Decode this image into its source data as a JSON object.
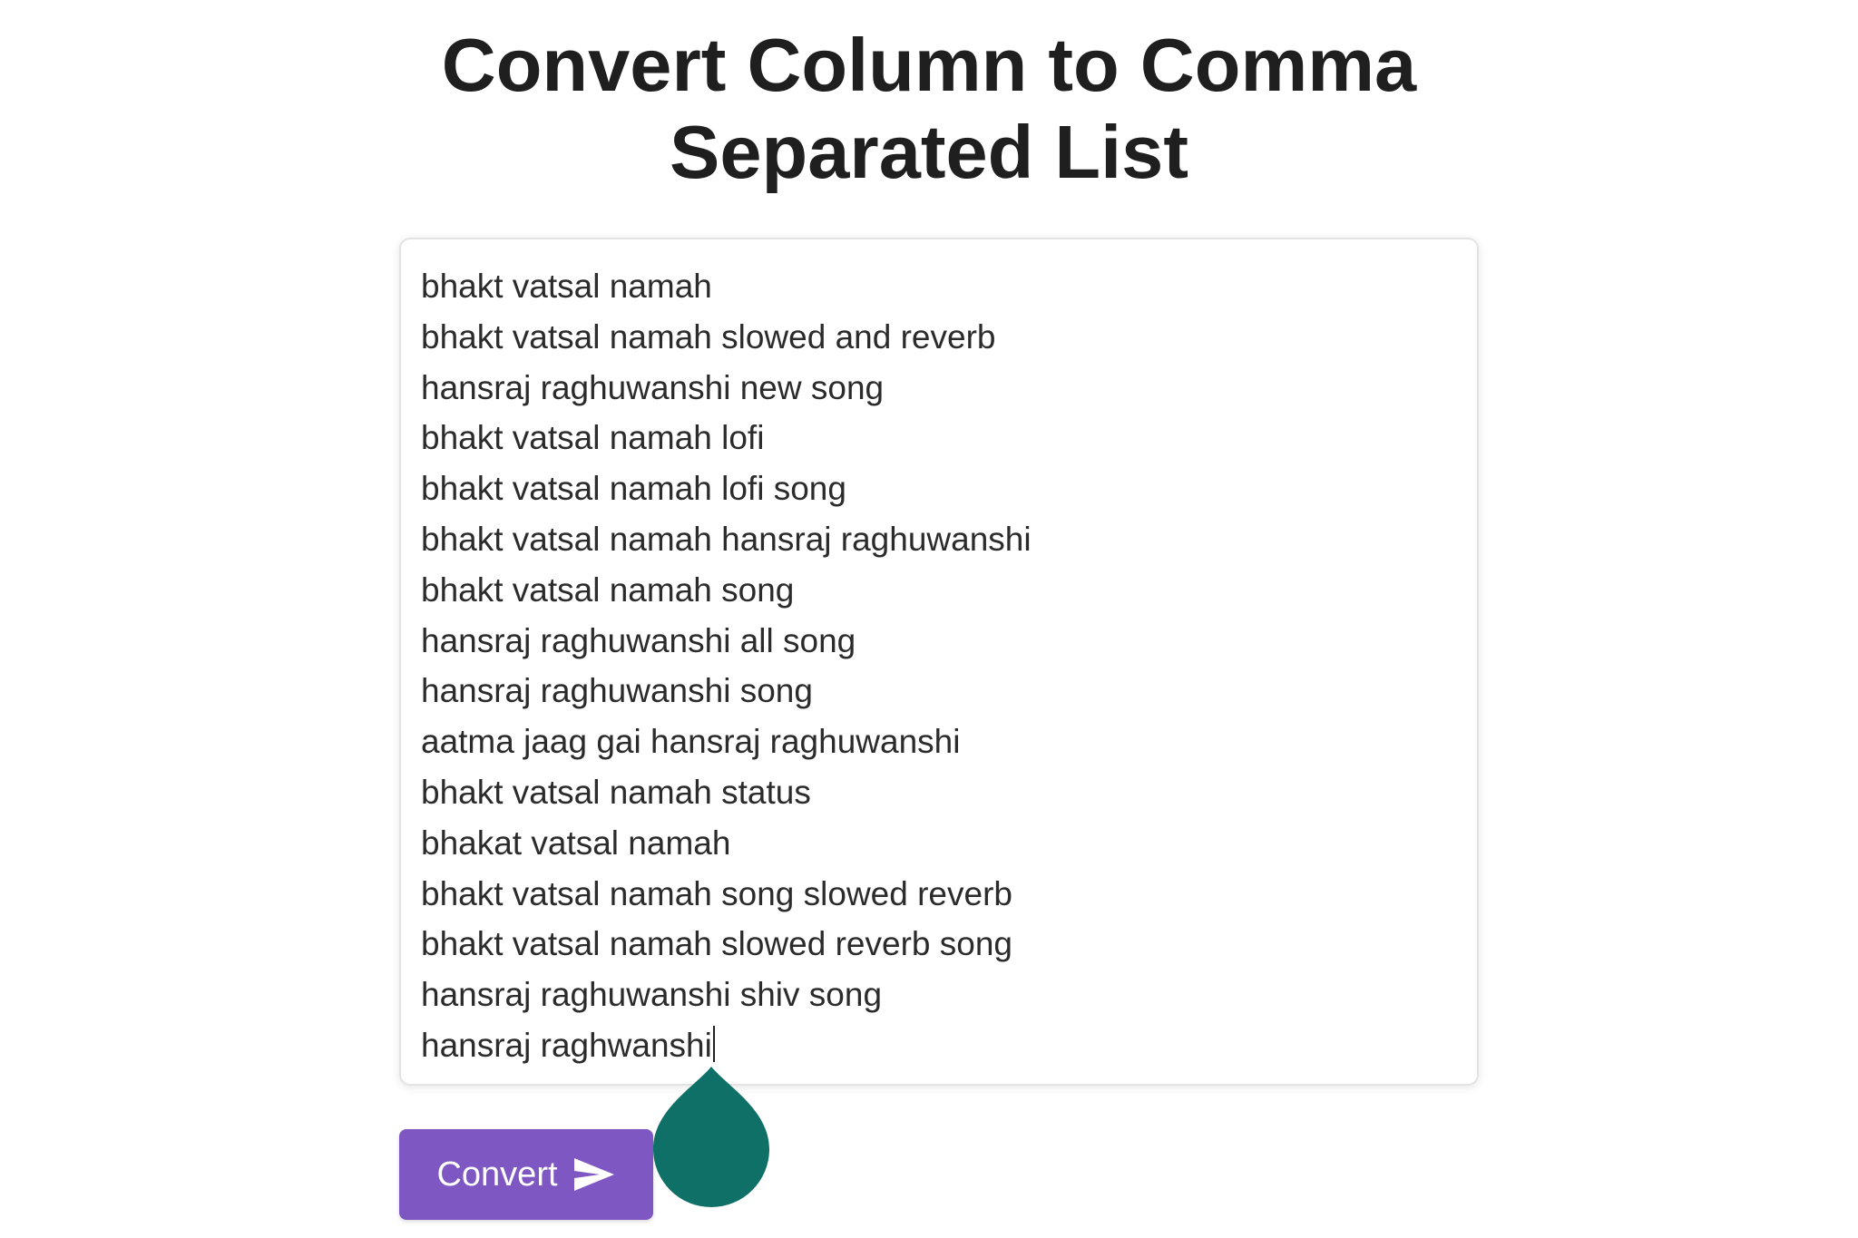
{
  "page": {
    "title_line1": "Convert Column to Comma",
    "title_line2": "Separated List"
  },
  "input": {
    "lines": [
      "bhakt vatsal namah",
      "bhakt vatsal namah slowed and reverb",
      "hansraj raghuwanshi new song",
      "bhakt vatsal namah lofi",
      "bhakt vatsal namah lofi song",
      "bhakt vatsal namah hansraj raghuwanshi",
      "bhakt vatsal namah song",
      "hansraj raghuwanshi all song",
      "hansraj raghuwanshi song",
      "aatma jaag gai hansraj raghuwanshi",
      "bhakt vatsal namah status",
      "bhakat vatsal namah",
      "bhakt vatsal namah song slowed reverb",
      "bhakt vatsal namah slowed reverb song",
      "hansraj raghuwanshi shiv song",
      "hansraj raghwanshi"
    ]
  },
  "toolbar": {
    "convert_label": "Convert",
    "convert_icon": "send-icon"
  },
  "selection_handle": {
    "icon": "text-selection-handle-icon",
    "color": "#0f7068"
  },
  "colors": {
    "accent": "#7e57c2",
    "handle": "#0f7068",
    "text": "#2b2b2b"
  }
}
